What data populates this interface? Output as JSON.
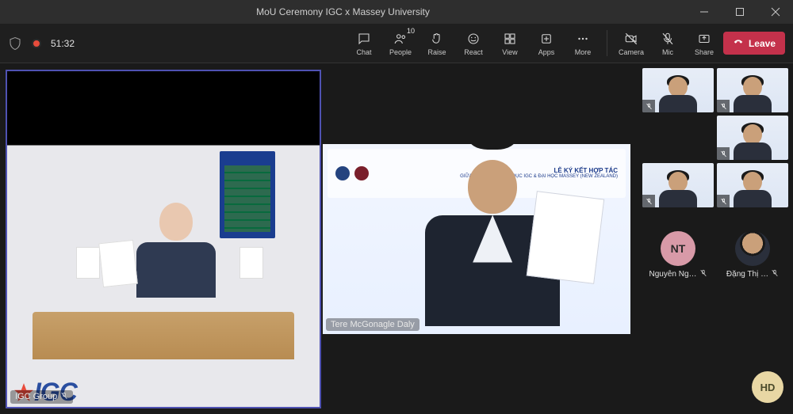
{
  "window": {
    "title": "MoU Ceremony IGC x Massey University"
  },
  "recording": {
    "elapsed": "51:32"
  },
  "toolbar": {
    "chat": "Chat",
    "people": "People",
    "people_count": "10",
    "raise": "Raise",
    "react": "React",
    "view": "View",
    "apps": "Apps",
    "more": "More",
    "camera": "Camera",
    "mic": "Mic",
    "share": "Share",
    "leave": "Leave"
  },
  "participants": {
    "tile1_label": "IGC Group",
    "tile2_label": "Tere McGonagle  Daly",
    "banner_title_line1": "LỄ KÝ KẾT HỢP TÁC",
    "banner_title_line2": "GIỮA TẬP ĐOÀN GIÁO DỤC IGC & ĐẠI HỌC MASSEY (NEW ZEALAND)",
    "avatar1_initials": "NT",
    "avatar1_name": "Nguyễn Ng…",
    "avatar2_name": "Đặng Thị …",
    "self_initials": "HD"
  },
  "watermark": {
    "text": "IGC"
  }
}
